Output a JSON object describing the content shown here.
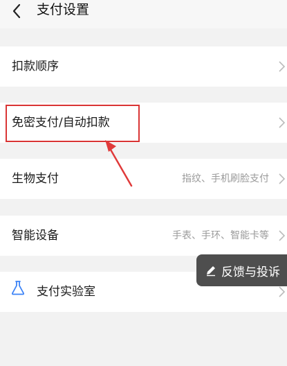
{
  "header": {
    "title": "支付设置",
    "back_icon": "chevron-left-icon"
  },
  "rows": [
    {
      "label": "扣款顺序",
      "value": ""
    },
    {
      "label": "免密支付/自动扣款",
      "value": ""
    },
    {
      "label": "生物支付",
      "value": "指纹、手机刷脸支付"
    },
    {
      "label": "智能设备",
      "value": "手表、手环、智能卡等"
    },
    {
      "label": "支付实验室",
      "value": "",
      "icon": "flask-icon"
    }
  ],
  "feedback": {
    "label": "反馈与投诉",
    "icon": "pen-icon"
  },
  "colors": {
    "highlight": "#d93434",
    "lab_icon": "#3b82f6",
    "feedback_bg": "#4e4e4e"
  }
}
